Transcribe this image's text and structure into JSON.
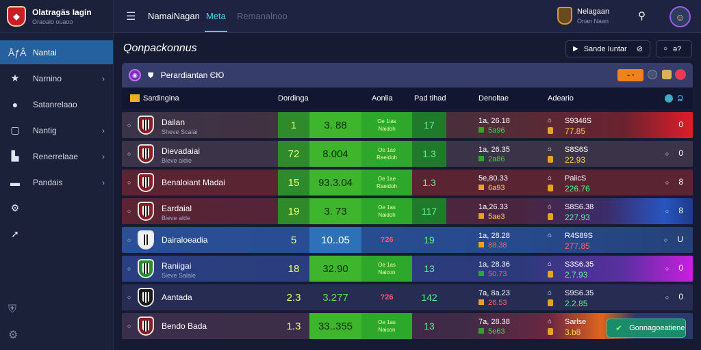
{
  "brand": {
    "title": "Olatragäs Iagin",
    "sub": "Oraoalo ouaoo"
  },
  "sidebar": {
    "items": [
      {
        "label": "Nantai",
        "icon": "tree-icon",
        "glyph": "ÅƒÂ",
        "chevron": false
      },
      {
        "label": "Narnino",
        "icon": "star-icon",
        "glyph": "★",
        "chevron": true
      },
      {
        "label": "Satanrelaao",
        "icon": "ball-icon",
        "glyph": "●",
        "chevron": false
      },
      {
        "label": "Nantig",
        "icon": "square-icon",
        "glyph": "▢",
        "chevron": true
      },
      {
        "label": "Renerrelaae",
        "icon": "chart-icon",
        "glyph": "▙",
        "chevron": true
      },
      {
        "label": "Pandais",
        "icon": "card-icon",
        "glyph": "▬",
        "chevron": true
      }
    ],
    "chevron_glyph": "›",
    "extra_icons": [
      {
        "icon": "gear-icon",
        "glyph": "⚙"
      },
      {
        "icon": "arrow-icon",
        "glyph": "➚"
      }
    ],
    "bottom_icons": [
      {
        "icon": "shield-icon",
        "glyph": "⛨"
      },
      {
        "icon": "settings-icon",
        "glyph": "⚙"
      }
    ]
  },
  "topbar": {
    "menu_glyph": "☰",
    "tabs": [
      "NamaiNagan",
      "Meta",
      "Remanalnoo"
    ],
    "user_name": "Nelagaan",
    "user_sub": "Onan Naan",
    "search_glyph": "⚲",
    "avatar_glyph": "☺"
  },
  "main": {
    "title": "Qonpackonnus",
    "sort_label": "Sande Iuntar",
    "sort_glyph": "▶",
    "sort_icon_glyph": "⊘",
    "btn2_glyph": "○",
    "btn2_label": "ə?"
  },
  "panel": {
    "title": "Perardiantan ЄЮ",
    "shield_glyph": "⛊",
    "chip_orange": "⌁ ⁿ",
    "columns": [
      "Sardingina",
      "Dordinga",
      "Aonlia",
      "Pad tihad",
      "Denoltae",
      "Adeario"
    ],
    "column_icon_glyph": "Ձ"
  },
  "rows": [
    {
      "name": "Dailan",
      "sub": "Sheve Scalai",
      "c1": "1",
      "c2": "3. 88",
      "c3a": "Oe 1ias",
      "c3b": "Naidoh",
      "c4": "17",
      "c5a": "1a, 26.18",
      "c5b": "5a96",
      "c6a": "S9346S",
      "c6b": "77.85",
      "end": "0"
    },
    {
      "name": "Dievadaiai",
      "sub": "Bieve aidie",
      "c1": "72",
      "c2": "8.004",
      "c3a": "Oe 1as",
      "c3b": "Raeidoh",
      "c4": "1.3",
      "c5a": "1a, 26.35",
      "c5b": "2a86",
      "c6a": "S8S6S",
      "c6b": "22.93",
      "end": "0"
    },
    {
      "name": "Benaloiant Madai",
      "sub": "",
      "c1": "15",
      "c2": "93.3.04",
      "c3a": "Oe 1ae",
      "c3b": "Raeidoh",
      "c4": "1.3",
      "c5a": "5e,80.33",
      "c5b": "6a93",
      "c6a": "PaiicS",
      "c6b": "226.76",
      "end": "8"
    },
    {
      "name": "Eardaial",
      "sub": "Bieve alde",
      "c1": "19",
      "c2": "3. 73",
      "c3a": "Oe 1as",
      "c3b": "Naidoh",
      "c4": "117",
      "c5a": "1a,26.33",
      "c5b": "5ae3",
      "c6a": "S8S6.38",
      "c6b": "227.93",
      "end": "8"
    },
    {
      "name": "Dairaloeadia",
      "sub": "",
      "c1": "5",
      "c2": "10..05",
      "c3a": "?26",
      "c3b": "",
      "c4": "19",
      "c5a": "1a, 28.28",
      "c5b": "88.38",
      "c6a": "R4S89S",
      "c6b": "277.85",
      "end": "U"
    },
    {
      "name": "Raniigai",
      "sub": "Sieve Salale",
      "c1": "18",
      "c2": "32.90",
      "c3a": "Oe 1as",
      "c3b": "Naicon",
      "c4": "13",
      "c5a": "1a, 28.36",
      "c5b": "50.73",
      "c6a": "S3S6.35",
      "c6b": "2.7.93",
      "end": "0"
    },
    {
      "name": "Aantada",
      "sub": "",
      "c1": "2.3",
      "c2": "3.277",
      "c3a": "?26",
      "c3b": "",
      "c4": "142",
      "c5a": "7a, 8a.23",
      "c5b": "26.53",
      "c6a": "S9S6.35",
      "c6b": "2.2.85",
      "end": "0"
    },
    {
      "name": "Bendo Bada",
      "sub": "",
      "c1": "1.3",
      "c2": "33..355",
      "c3a": "Oe 1as",
      "c3b": "Naicon",
      "c4": "13",
      "c5a": "7a, 28.38",
      "c5b": "5e63",
      "c6a": "Sarlse",
      "c6b": "3.b8",
      "end": ""
    }
  ],
  "follow_button": {
    "label": "Gonnagoeatiene",
    "glyph": "✔"
  }
}
